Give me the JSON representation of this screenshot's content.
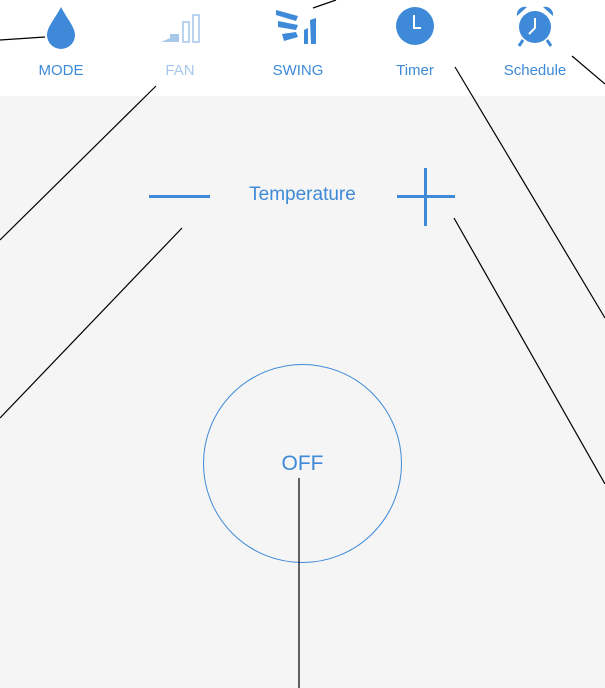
{
  "toolbar": {
    "mode_label": "MODE",
    "fan_label": "FAN",
    "swing_label": "SWING",
    "timer_label": "Timer",
    "schedule_label": "Schedule"
  },
  "controls": {
    "temperature_label": "Temperature",
    "power_label": "OFF"
  },
  "colors": {
    "accent": "#3e8ad8",
    "accent_dim": "#a8c8ea",
    "panel_bg": "#f5f5f5"
  },
  "icons": [
    "water-drop-icon",
    "fan-signal-icon",
    "swing-icon",
    "clock-icon",
    "alarm-clock-icon",
    "minus-icon",
    "plus-icon"
  ]
}
